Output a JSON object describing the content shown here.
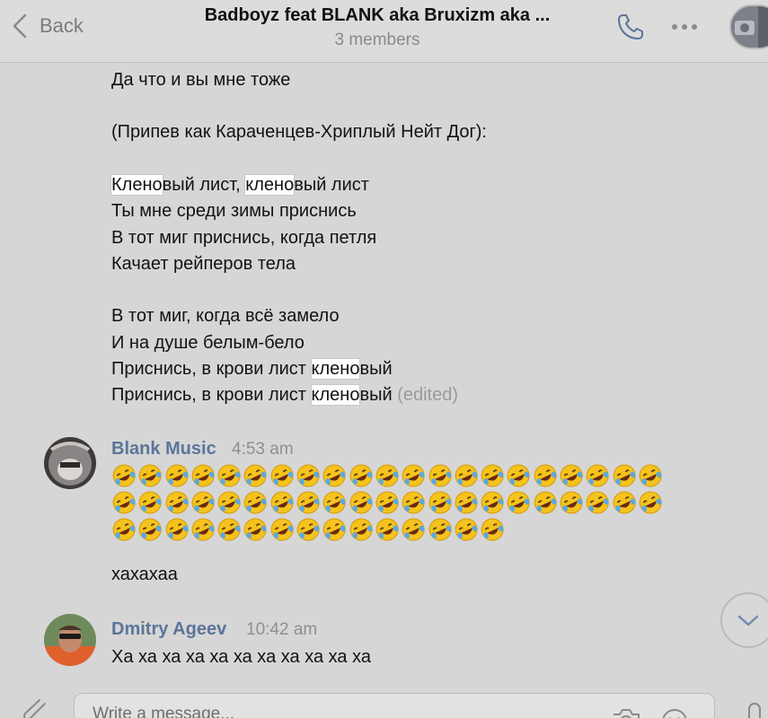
{
  "header": {
    "back_label": "Back",
    "title": "Badboyz feat BLANK aka Bruxizm aka ...",
    "subtitle": "3 members"
  },
  "message1": {
    "lines": {
      "l1": "Да что и вы мне тоже",
      "l2": "(Припев как Караченцев-Хриплый Нейт Дог):",
      "l3a": "Клено",
      "l3b": "вый лист, ",
      "l3c": "клено",
      "l3d": "вый лист",
      "l4": "Ты мне среди зимы приснись",
      "l5": "В тот миг приснись, когда петля",
      "l6": "Качает рейперов тела",
      "l7": "В тот миг, когда всё замело",
      "l8": "И на душе белым-бело",
      "l9a": "Приснись, в крови лист ",
      "l9b": "клено",
      "l9c": "вый",
      "l10a": "Приснись, в крови лист ",
      "l10b": "клено",
      "l10c": "вый",
      "edited": "(edited)"
    }
  },
  "message2": {
    "sender": "Blank Music",
    "time": "4:53 am",
    "emoji_rows": [
      21,
      21,
      15
    ],
    "emoji_name": "rolling-on-the-floor-laughing-emoji",
    "text": "хахахаа"
  },
  "message3": {
    "sender": "Dmitry Ageev",
    "time": "10:42 am",
    "text": "Ха ха ха ха ха ха ха ха ха ха ха"
  },
  "composer": {
    "placeholder": "Write a message..."
  },
  "colors": {
    "background": "#d6d6d6",
    "sender_name": "#5b7599",
    "highlight": "#ffffff",
    "emoji_yellow": "#f5c31c"
  }
}
